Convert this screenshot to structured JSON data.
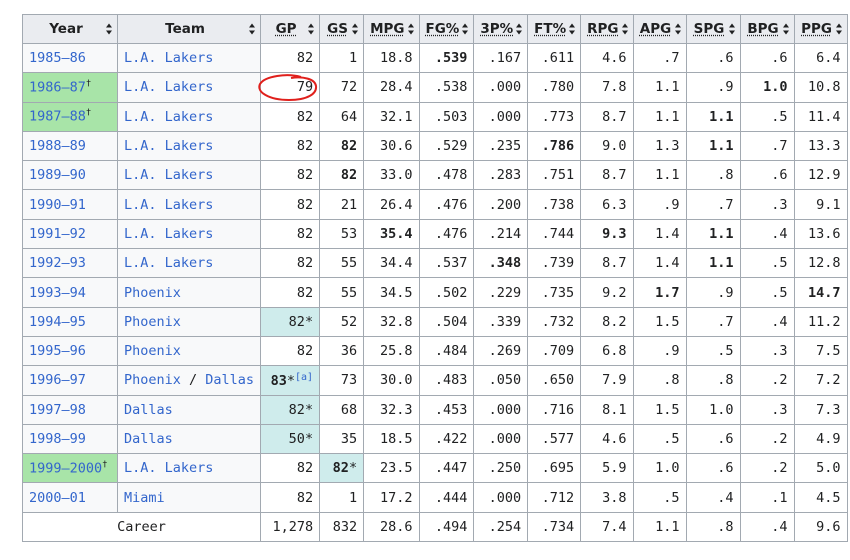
{
  "headers": [
    {
      "label": "Year",
      "abbr": false
    },
    {
      "label": "Team",
      "abbr": false
    },
    {
      "label": "GP",
      "abbr": true
    },
    {
      "label": "GS",
      "abbr": true
    },
    {
      "label": "MPG",
      "abbr": true
    },
    {
      "label": "FG%",
      "abbr": true
    },
    {
      "label": "3P%",
      "abbr": true
    },
    {
      "label": "FT%",
      "abbr": true
    },
    {
      "label": "RPG",
      "abbr": true
    },
    {
      "label": "APG",
      "abbr": true
    },
    {
      "label": "SPG",
      "abbr": true
    },
    {
      "label": "BPG",
      "abbr": true
    },
    {
      "label": "PPG",
      "abbr": true
    }
  ],
  "rows": [
    {
      "year": "1985–86",
      "champ": false,
      "teams": [
        "L.A. Lakers"
      ],
      "stats": [
        "82",
        "1",
        "18.8",
        ".539",
        ".167",
        ".611",
        "4.6",
        ".7",
        ".6",
        ".6",
        "6.4"
      ],
      "bold": [
        3
      ],
      "lead": [],
      "star": [],
      "ref": null
    },
    {
      "year": "1986–87",
      "champ": true,
      "teams": [
        "L.A. Lakers"
      ],
      "stats": [
        "79",
        "72",
        "28.4",
        ".538",
        ".000",
        ".780",
        "7.8",
        "1.1",
        ".9",
        "1.0",
        "10.8"
      ],
      "bold": [
        9
      ],
      "lead": [],
      "star": [],
      "ref": null
    },
    {
      "year": "1987–88",
      "champ": true,
      "teams": [
        "L.A. Lakers"
      ],
      "stats": [
        "82",
        "64",
        "32.1",
        ".503",
        ".000",
        ".773",
        "8.7",
        "1.1",
        "1.1",
        ".5",
        "11.4"
      ],
      "bold": [
        8
      ],
      "lead": [],
      "star": [],
      "ref": null
    },
    {
      "year": "1988–89",
      "champ": false,
      "teams": [
        "L.A. Lakers"
      ],
      "stats": [
        "82",
        "82",
        "30.6",
        ".529",
        ".235",
        ".786",
        "9.0",
        "1.3",
        "1.1",
        ".7",
        "13.3"
      ],
      "bold": [
        1,
        5,
        8
      ],
      "lead": [],
      "star": [],
      "ref": null
    },
    {
      "year": "1989–90",
      "champ": false,
      "teams": [
        "L.A. Lakers"
      ],
      "stats": [
        "82",
        "82",
        "33.0",
        ".478",
        ".283",
        ".751",
        "8.7",
        "1.1",
        ".8",
        ".6",
        "12.9"
      ],
      "bold": [
        1
      ],
      "lead": [],
      "star": [],
      "ref": null
    },
    {
      "year": "1990–91",
      "champ": false,
      "teams": [
        "L.A. Lakers"
      ],
      "stats": [
        "82",
        "21",
        "26.4",
        ".476",
        ".200",
        ".738",
        "6.3",
        ".9",
        ".7",
        ".3",
        "9.1"
      ],
      "bold": [],
      "lead": [],
      "star": [],
      "ref": null
    },
    {
      "year": "1991–92",
      "champ": false,
      "teams": [
        "L.A. Lakers"
      ],
      "stats": [
        "82",
        "53",
        "35.4",
        ".476",
        ".214",
        ".744",
        "9.3",
        "1.4",
        "1.1",
        ".4",
        "13.6"
      ],
      "bold": [
        2,
        6,
        8
      ],
      "lead": [],
      "star": [],
      "ref": null
    },
    {
      "year": "1992–93",
      "champ": false,
      "teams": [
        "L.A. Lakers"
      ],
      "stats": [
        "82",
        "55",
        "34.4",
        ".537",
        ".348",
        ".739",
        "8.7",
        "1.4",
        "1.1",
        ".5",
        "12.8"
      ],
      "bold": [
        4,
        8
      ],
      "lead": [],
      "star": [],
      "ref": null
    },
    {
      "year": "1993–94",
      "champ": false,
      "teams": [
        "Phoenix"
      ],
      "stats": [
        "82",
        "55",
        "34.5",
        ".502",
        ".229",
        ".735",
        "9.2",
        "1.7",
        ".9",
        ".5",
        "14.7"
      ],
      "bold": [
        7,
        10
      ],
      "lead": [],
      "star": [],
      "ref": null
    },
    {
      "year": "1994–95",
      "champ": false,
      "teams": [
        "Phoenix"
      ],
      "stats": [
        "82",
        "52",
        "32.8",
        ".504",
        ".339",
        ".732",
        "8.2",
        "1.5",
        ".7",
        ".4",
        "11.2"
      ],
      "bold": [],
      "lead": [
        0
      ],
      "star": [
        0
      ],
      "ref": null
    },
    {
      "year": "1995–96",
      "champ": false,
      "teams": [
        "Phoenix"
      ],
      "stats": [
        "82",
        "36",
        "25.8",
        ".484",
        ".269",
        ".709",
        "6.8",
        ".9",
        ".5",
        ".3",
        "7.5"
      ],
      "bold": [],
      "lead": [],
      "star": [],
      "ref": null
    },
    {
      "year": "1996–97",
      "champ": false,
      "teams": [
        "Phoenix",
        "Dallas"
      ],
      "stats": [
        "83",
        "73",
        "30.0",
        ".483",
        ".050",
        ".650",
        "7.9",
        ".8",
        ".8",
        ".2",
        "7.2"
      ],
      "bold": [
        0
      ],
      "lead": [
        0
      ],
      "star": [
        0
      ],
      "ref": "[a]"
    },
    {
      "year": "1997–98",
      "champ": false,
      "teams": [
        "Dallas"
      ],
      "stats": [
        "82",
        "68",
        "32.3",
        ".453",
        ".000",
        ".716",
        "8.1",
        "1.5",
        "1.0",
        ".3",
        "7.3"
      ],
      "bold": [],
      "lead": [
        0
      ],
      "star": [
        0
      ],
      "ref": null
    },
    {
      "year": "1998–99",
      "champ": false,
      "teams": [
        "Dallas"
      ],
      "stats": [
        "50",
        "35",
        "18.5",
        ".422",
        ".000",
        ".577",
        "4.6",
        ".5",
        ".6",
        ".2",
        "4.9"
      ],
      "bold": [],
      "lead": [
        0
      ],
      "star": [
        0
      ],
      "ref": null
    },
    {
      "year": "1999–2000",
      "champ": true,
      "teams": [
        "L.A. Lakers"
      ],
      "stats": [
        "82",
        "82",
        "23.5",
        ".447",
        ".250",
        ".695",
        "5.9",
        "1.0",
        ".6",
        ".2",
        "5.0"
      ],
      "bold": [
        1
      ],
      "lead": [
        1
      ],
      "star": [
        1
      ],
      "ref": null
    },
    {
      "year": "2000–01",
      "champ": false,
      "teams": [
        "Miami"
      ],
      "stats": [
        "82",
        "1",
        "17.2",
        ".444",
        ".000",
        ".712",
        "3.8",
        ".5",
        ".4",
        ".1",
        "4.5"
      ],
      "bold": [],
      "lead": [],
      "star": [],
      "ref": null
    }
  ],
  "career": {
    "label": "Career",
    "stats": [
      "1,278",
      "832",
      "28.6",
      ".494",
      ".254",
      ".734",
      "7.4",
      "1.1",
      ".8",
      ".4",
      "9.6"
    ]
  },
  "champ_mark": "†",
  "team_separator": " / ",
  "star_mark": "*",
  "colors": {
    "link": "#3366cc",
    "champ": "#a8e4a8",
    "lead": "#cfecec",
    "header": "#eaecf0",
    "annotation": "#e0201c"
  }
}
